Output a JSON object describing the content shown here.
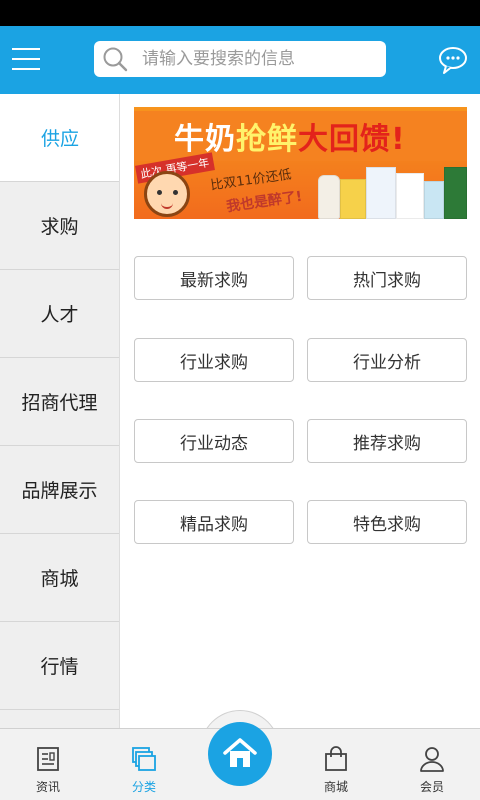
{
  "header": {
    "search_placeholder": "请输入要搜索的信息",
    "menu_icon": "menu-icon",
    "search_icon": "search-icon",
    "message_icon": "chat-bubble-icon"
  },
  "sidebar": {
    "items": [
      {
        "label": "供应",
        "active": true
      },
      {
        "label": "求购",
        "active": false
      },
      {
        "label": "人才",
        "active": false
      },
      {
        "label": "招商代理",
        "active": false
      },
      {
        "label": "品牌展示",
        "active": false
      },
      {
        "label": "商城",
        "active": false
      },
      {
        "label": "行情",
        "active": false
      }
    ]
  },
  "banner": {
    "headline_part1": "牛奶",
    "headline_part2": "抢鲜",
    "headline_part3": "大回馈!",
    "tag": "此次 再等一年",
    "promo_line1": "比双11价还低",
    "promo_line2": "我也是醉了!"
  },
  "categories": [
    "最新求购",
    "热门求购",
    "行业求购",
    "行业分析",
    "行业动态",
    "推荐求购",
    "精品求购",
    "特色求购"
  ],
  "tabbar": {
    "tabs": [
      {
        "label": "资讯",
        "icon": "news-icon",
        "active": false
      },
      {
        "label": "分类",
        "icon": "category-icon",
        "active": true
      },
      {
        "label": "商城",
        "icon": "shopping-bag-icon",
        "active": false
      },
      {
        "label": "会员",
        "icon": "user-icon",
        "active": false
      }
    ],
    "home_icon": "home-icon"
  },
  "colors": {
    "accent": "#1ba3e3",
    "status_bar": "#000000",
    "sidebar_bg": "#efefef",
    "tabbar_bg": "#f2f2f2"
  }
}
